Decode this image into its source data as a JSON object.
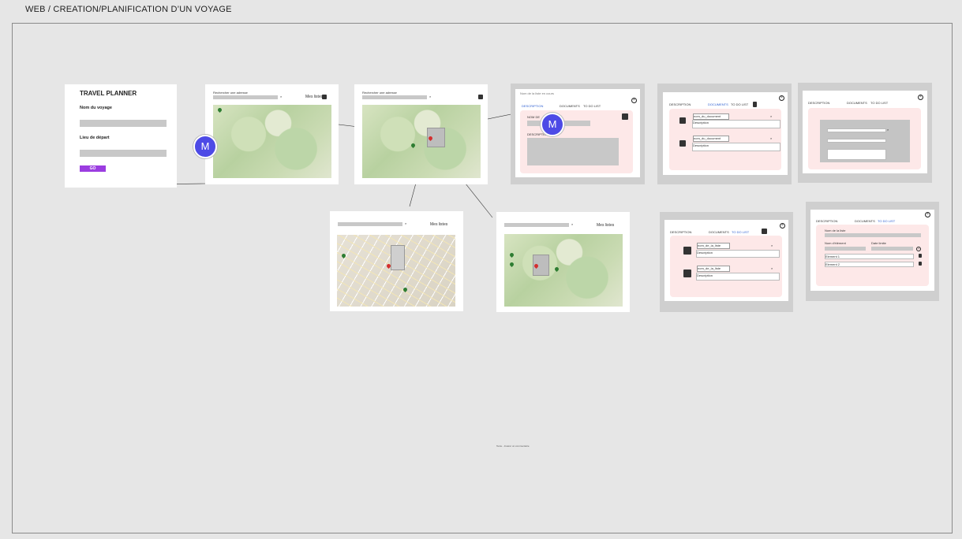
{
  "board": {
    "title": "WEB / CREATION/PLANIFICATION D’UN VOYAGE"
  },
  "form": {
    "title": "TRAVEL PLANNER",
    "trip_label": "Nom du voyage",
    "departure_label": "Lieu de départ",
    "go_label": "GO",
    "accent": "#9b3de0"
  },
  "map_screens": {
    "search_label": "Rechercher une adresse",
    "lists_label": "Mes listes"
  },
  "tabs": {
    "description": "DESCRIPTION",
    "documents": "DOCUMENTS",
    "todo": "TO DO LIST"
  },
  "description_panel": {
    "header": "Nom de la liste en cours",
    "name_label": "NOM DE",
    "desc_label": "DESCRIPTION"
  },
  "documents_panel": {
    "items": [
      {
        "name": "nom_du_document",
        "desc": "Description"
      },
      {
        "name": "nom_du_document",
        "desc": "Description"
      }
    ]
  },
  "todo_panel": {
    "items": [
      {
        "name": "nom_de_la_liste",
        "desc": "Description"
      },
      {
        "name": "nom_de_la_liste",
        "desc": "Description"
      }
    ]
  },
  "list_editor": {
    "list_name_label": "Nom de la liste",
    "element_name_label": "Nom d'élément",
    "date_label": "Date limite",
    "elements": [
      "Element 1",
      "Element 2"
    ]
  },
  "collaborator": {
    "initial": "M",
    "color": "#4d4ae6"
  },
  "footer_note": "Texte - Insérer un commentaire"
}
